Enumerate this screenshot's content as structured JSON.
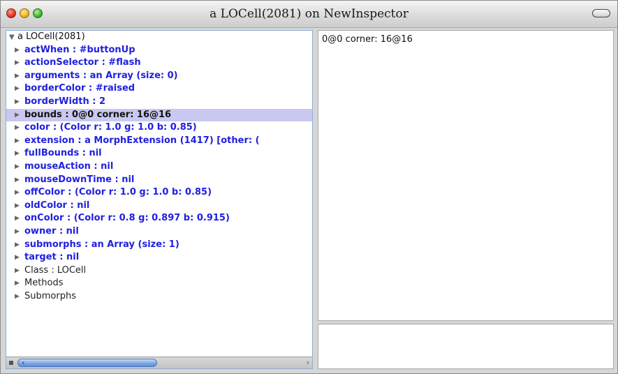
{
  "window": {
    "title": "a LOCell(2081) on NewInspector"
  },
  "tree": {
    "root_label": "a LOCell(2081)",
    "items": [
      {
        "label": "actWhen : #buttonUp",
        "kind": "field"
      },
      {
        "label": "actionSelector : #flash",
        "kind": "field"
      },
      {
        "label": "arguments : an Array (size: 0)",
        "kind": "field"
      },
      {
        "label": "borderColor : #raised",
        "kind": "field"
      },
      {
        "label": "borderWidth : 2",
        "kind": "field"
      },
      {
        "label": "bounds : 0@0 corner: 16@16",
        "kind": "field",
        "selected": true
      },
      {
        "label": "color : (Color r: 1.0 g: 1.0 b: 0.85)",
        "kind": "field"
      },
      {
        "label": "extension : a MorphExtension (1417) [other:  (",
        "kind": "field"
      },
      {
        "label": "fullBounds : nil",
        "kind": "field"
      },
      {
        "label": "mouseAction : nil",
        "kind": "field"
      },
      {
        "label": "mouseDownTime : nil",
        "kind": "field"
      },
      {
        "label": "offColor : (Color r: 1.0 g: 1.0 b: 0.85)",
        "kind": "field"
      },
      {
        "label": "oldColor : nil",
        "kind": "field"
      },
      {
        "label": "onColor : (Color r: 0.8 g: 0.897 b: 0.915)",
        "kind": "field"
      },
      {
        "label": "owner : nil",
        "kind": "field"
      },
      {
        "label": "submorphs : an Array (size: 1)",
        "kind": "field"
      },
      {
        "label": "target : nil",
        "kind": "field"
      },
      {
        "label": "Class : LOCell",
        "kind": "plain"
      },
      {
        "label": "Methods",
        "kind": "plain"
      },
      {
        "label": "Submorphs",
        "kind": "plain"
      }
    ]
  },
  "value_pane": {
    "text": "0@0 corner: 16@16"
  },
  "eval_pane": {
    "text": ""
  },
  "colors": {
    "field_text": "#2020e0",
    "selection": "#c8c8f0"
  }
}
